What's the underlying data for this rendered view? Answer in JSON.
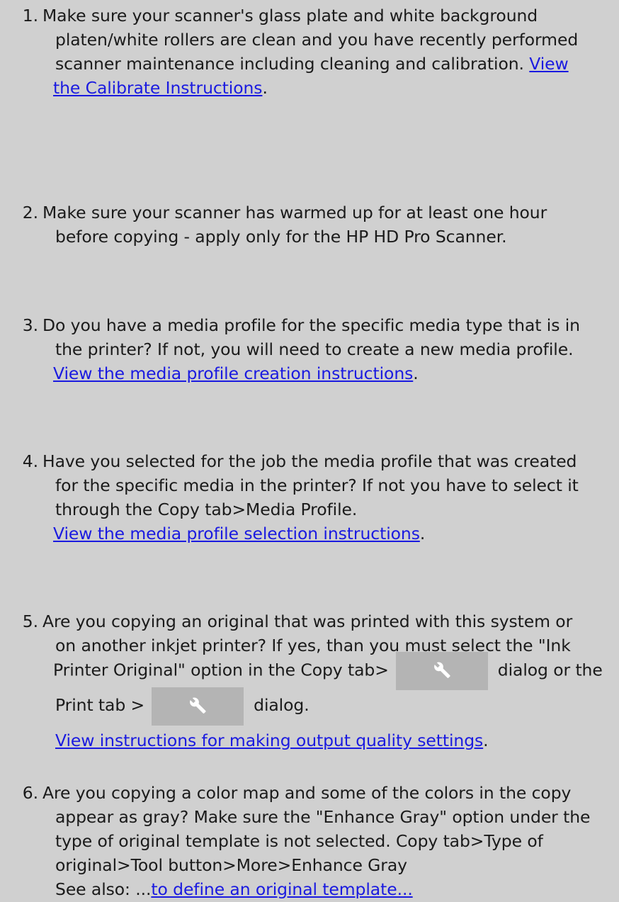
{
  "steps": [
    {
      "number": "1.",
      "lines": [
        "Make sure your scanner's glass plate and white background",
        "platen/white rollers are clean and you have recently performed",
        "scanner maintenance including cleaning and calibration."
      ],
      "link_part1": "View",
      "link_part2": " the Calibrate Instructions",
      "link_suffix": "."
    },
    {
      "number": "2.",
      "lines": [
        "Make sure your scanner has warmed up for at least one hour",
        "before copying - apply only for the HP HD Pro Scanner."
      ]
    },
    {
      "number": "3.",
      "lines": [
        "Do you have a media profile for the specific media type that is in",
        "the printer? If not, you will need to create a new media profile."
      ],
      "link": "View the media profile creation instructions",
      "link_suffix": "."
    },
    {
      "number": "4.",
      "lines": [
        "Have you selected for the job the media profile that was created",
        "for the specific media in the printer? If not you have to select it",
        "through the Copy tab>Media Profile."
      ],
      "link": "View the media profile selection instructions",
      "link_suffix": "."
    },
    {
      "number": "5.",
      "lines": [
        "Are you copying an original that was printed with this system or",
        "on another inkjet printer? If yes, than you must select the \"Ink",
        "Printer Original\" option in the Copy tab>",
        "dialog or the",
        "Print tab >",
        "dialog."
      ],
      "link": "View instructions for making output quality settings",
      "link_suffix": "."
    },
    {
      "number": "6.",
      "lines": [
        "Are you copying a color map and some of the colors in the copy",
        "appear as gray? Make sure the \"Enhance Gray\" option under the",
        "type of original template is not selected. Copy tab>Type of",
        "original>Tool button>More>Enhance Gray",
        "See also: ..."
      ],
      "link": "to define an original template..."
    }
  ],
  "icons": {
    "tool_button_icon": "wrench-icon"
  },
  "colors": {
    "background": "#d0d0d0",
    "link": "#1a1ae0",
    "button": "#b4b4b4"
  }
}
